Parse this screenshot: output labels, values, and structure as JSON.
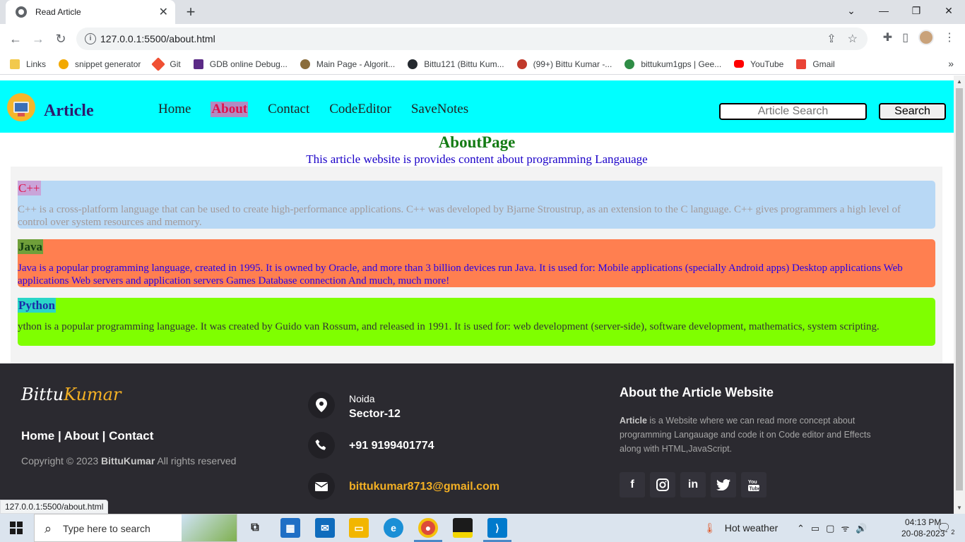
{
  "browser": {
    "tab_title": "Read Article",
    "url": "127.0.0.1:5500/about.html",
    "status_url": "127.0.0.1:5500/about.html",
    "bookmarks": [
      {
        "label": "Links",
        "color": "#f2c94c"
      },
      {
        "label": "snippet generator",
        "color": "#f2a900"
      },
      {
        "label": "Git",
        "color": "#f05033"
      },
      {
        "label": "GDB online Debug...",
        "color": "#5b2a86"
      },
      {
        "label": "Main Page - Algorit...",
        "color": "#8a6d3b"
      },
      {
        "label": "Bittu121 (Bittu Kum...",
        "color": "#24292e"
      },
      {
        "label": "(99+) Bittu Kumar -...",
        "color": "#c0392b"
      },
      {
        "label": "bittukum1gps | Gee...",
        "color": "#2f8d46"
      },
      {
        "label": "YouTube",
        "color": "#ff0000"
      },
      {
        "label": "Gmail",
        "color": "#ea4335"
      }
    ]
  },
  "site": {
    "brand": "Article",
    "nav": [
      {
        "label": "Home",
        "active": false
      },
      {
        "label": "About",
        "active": true
      },
      {
        "label": "Contact",
        "active": false
      },
      {
        "label": "CodeEditor",
        "active": false
      },
      {
        "label": "SaveNotes",
        "active": false
      }
    ],
    "search_placeholder": "Article Search",
    "search_button": "Search"
  },
  "about": {
    "title": "AboutPage",
    "subtitle": "This article website is provides content about programming Langauage"
  },
  "cards": [
    {
      "title": "C++",
      "text": "C++ is a cross-platform language that can be used to create high-performance applications. C++ was developed by Bjarne Stroustrup, as an extension to the C language. C++ gives programmers a high level of control over system resources and memory."
    },
    {
      "title": "Java",
      "text": "Java is a popular programming language, created in 1995. It is owned by Oracle, and more than 3 billion devices run Java. It is used for: Mobile applications (specially Android apps) Desktop applications Web applications Web servers and application servers Games Database connection And much, much more!"
    },
    {
      "title": "Python",
      "text": "ython is a popular programming language. It was created by Guido van Rossum, and released in 1991. It is used for: web development (server-side), software development, mathematics, system scripting."
    }
  ],
  "footer": {
    "logo_first": "Bittu",
    "logo_second": "Kumar",
    "links": "Home | About | Contact",
    "copyright_prefix": "Copyright © 2023 ",
    "copyright_name": "BittuKumar",
    "copyright_suffix": " All rights reserved",
    "location_city": "Noida",
    "location_sector": "Sector-12",
    "phone": "+91 9199401774",
    "email": "bittukumar8713@gmail.com",
    "about_heading": "About the Article Website",
    "about_bold": "Article",
    "about_text": " is a Website where we can read more concept about programming Langauage and code it on Code editor and Effects along with HTML,JavaScript.",
    "socials": [
      "facebook-icon",
      "instagram-icon",
      "linkedin-icon",
      "twitter-icon",
      "youtube-icon"
    ]
  },
  "taskbar": {
    "search_placeholder": "Type here to search",
    "weather": "Hot weather",
    "time": "04:13 PM",
    "date": "20-08-2023",
    "notifications": "2"
  }
}
